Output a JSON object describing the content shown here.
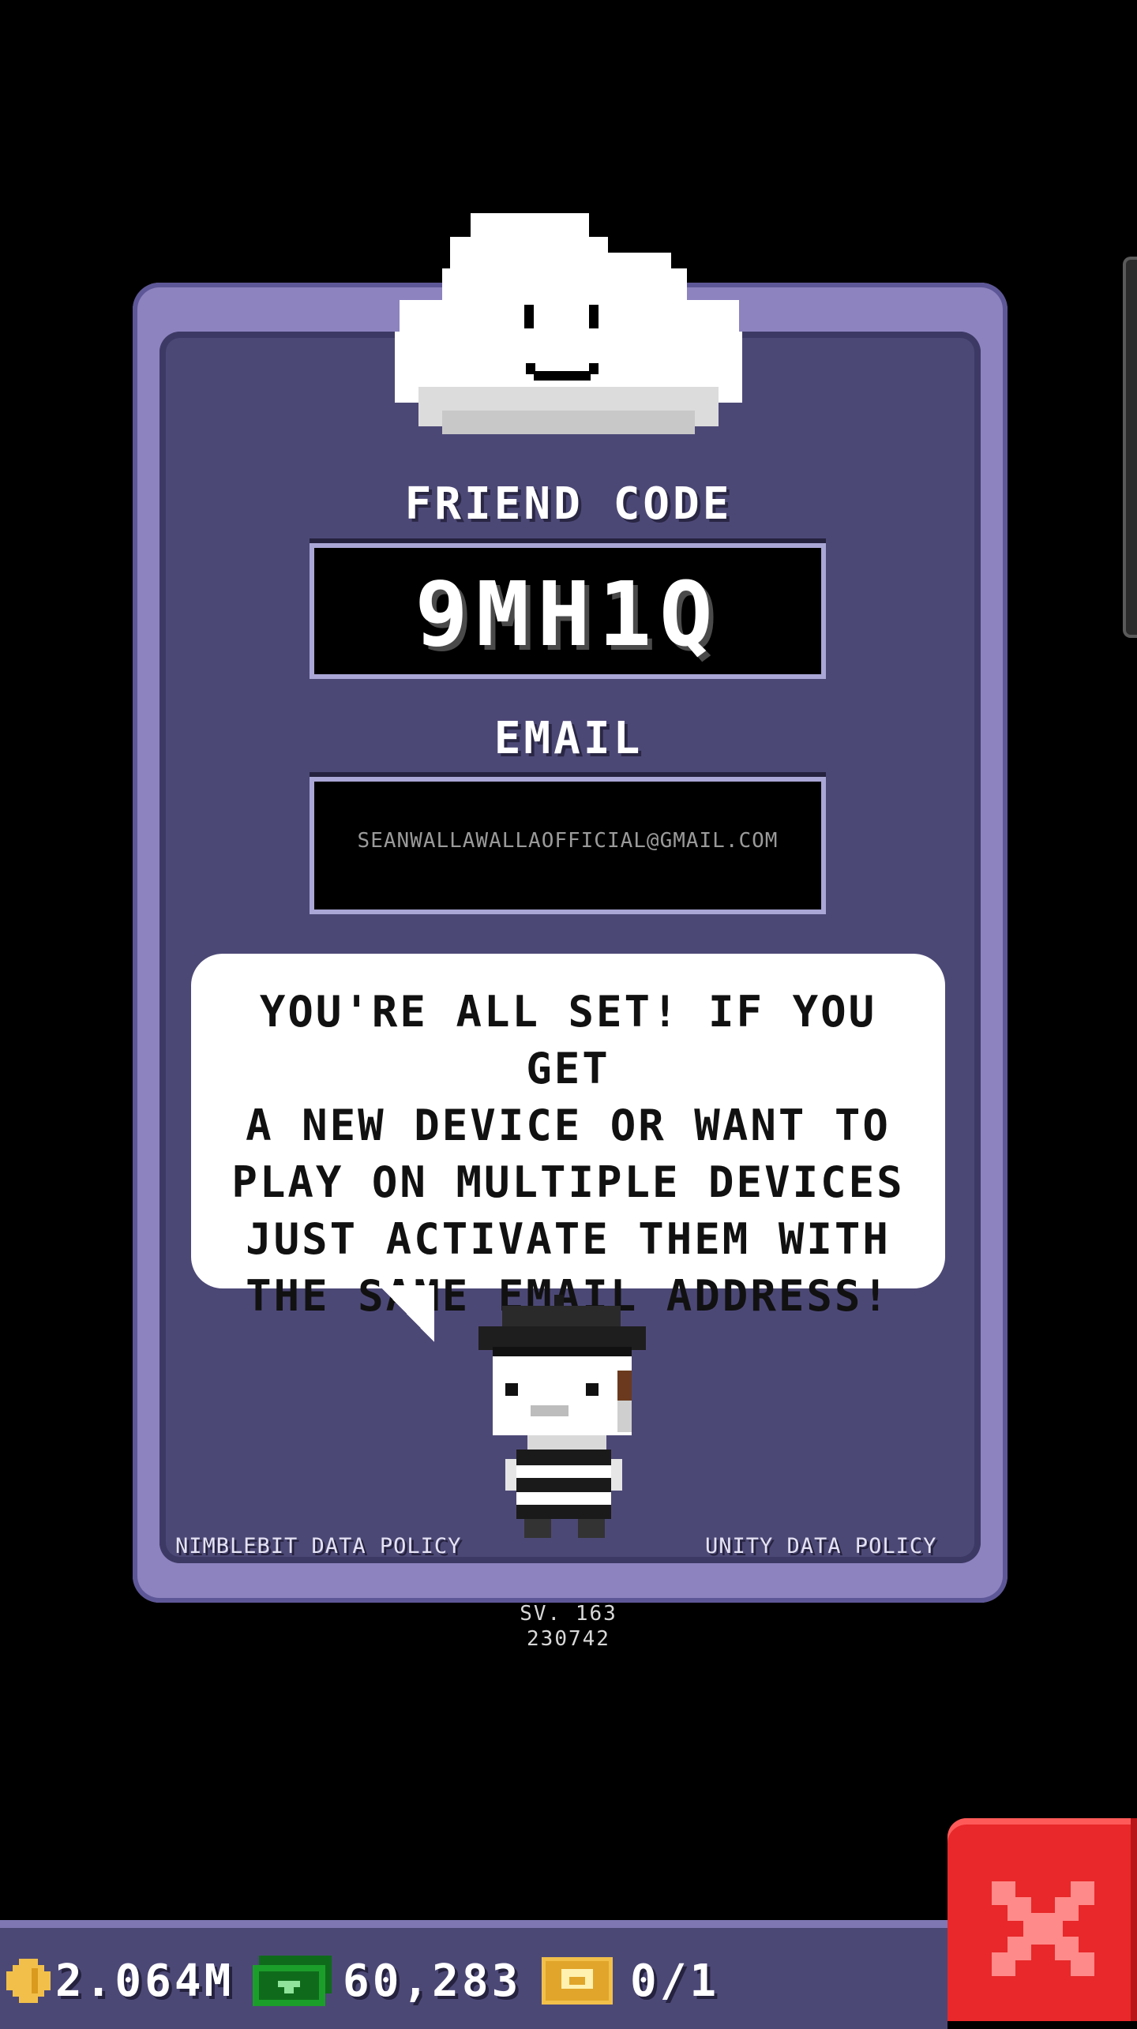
{
  "panel": {
    "friend_code_label": "FRIEND CODE",
    "friend_code": "9MH1Q",
    "email_label": "EMAIL",
    "email": "SEANWALLAWALLAOFFICIAL@GMAIL.COM"
  },
  "bubble": {
    "lines": [
      "YOU'RE ALL SET! IF YOU GET",
      "A NEW DEVICE OR WANT TO",
      "PLAY ON MULTIPLE DEVICES",
      "JUST ACTIVATE THEM WITH",
      "THE SAME EMAIL ADDRESS!"
    ]
  },
  "links": {
    "nimblebit_policy": "NIMBLEBIT DATA POLICY",
    "unity_policy": "UNITY DATA POLICY"
  },
  "version": {
    "line1": "SV. 163",
    "line2": "230742"
  },
  "stats": {
    "coins": "2.064M",
    "bux": "60,283",
    "tickets": "0/1"
  },
  "icons": {
    "coin": "coin-icon",
    "bux": "bux-icon",
    "ticket": "ticket-icon",
    "close": "close-icon",
    "cloud": "cloud-mascot-icon",
    "mime": "mime-character-icon"
  },
  "colors": {
    "panel": "#8c83bf",
    "panel_inner": "#4c4876",
    "close_button": "#e8282a"
  }
}
